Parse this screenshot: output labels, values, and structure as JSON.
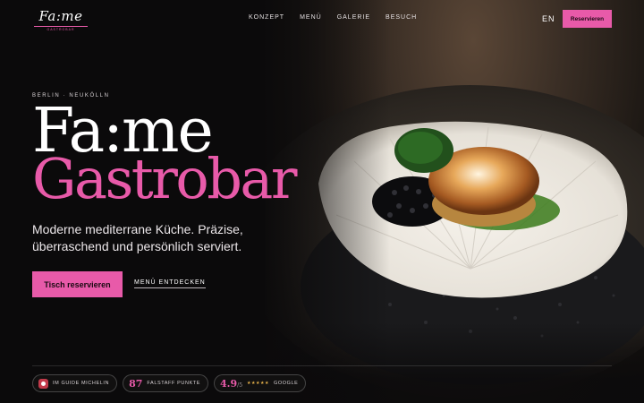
{
  "brand": {
    "logo": "Fa:me",
    "logo_sub": "GASTROBAR"
  },
  "nav": {
    "items": [
      "KONZEPT",
      "MENÜ",
      "GALERIE",
      "BESUCH"
    ]
  },
  "header": {
    "lang": "EN",
    "cta": "Reservieren"
  },
  "hero": {
    "eyebrow": "BERLIN · NEUKÖLLN",
    "title_line1": "Fa:me",
    "title_line2": "Gastrobar",
    "lead": "Moderne mediterrane Küche. Präzise, überraschend und persönlich serviert.",
    "primary_cta": "Tisch reservieren",
    "secondary_cta": "MENÜ ENTDECKEN"
  },
  "badges": {
    "michelin": {
      "label": "IM GUIDE MICHELIN",
      "icon": "michelin-icon"
    },
    "falstaff": {
      "value": "87",
      "label": "FALSTAFF PUNKTE"
    },
    "google": {
      "value": "4.9",
      "scale": "/5",
      "stars": "★★★★★",
      "label": "GOOGLE"
    }
  },
  "colors": {
    "accent": "#e85aa9",
    "background": "#0b0a0b"
  }
}
